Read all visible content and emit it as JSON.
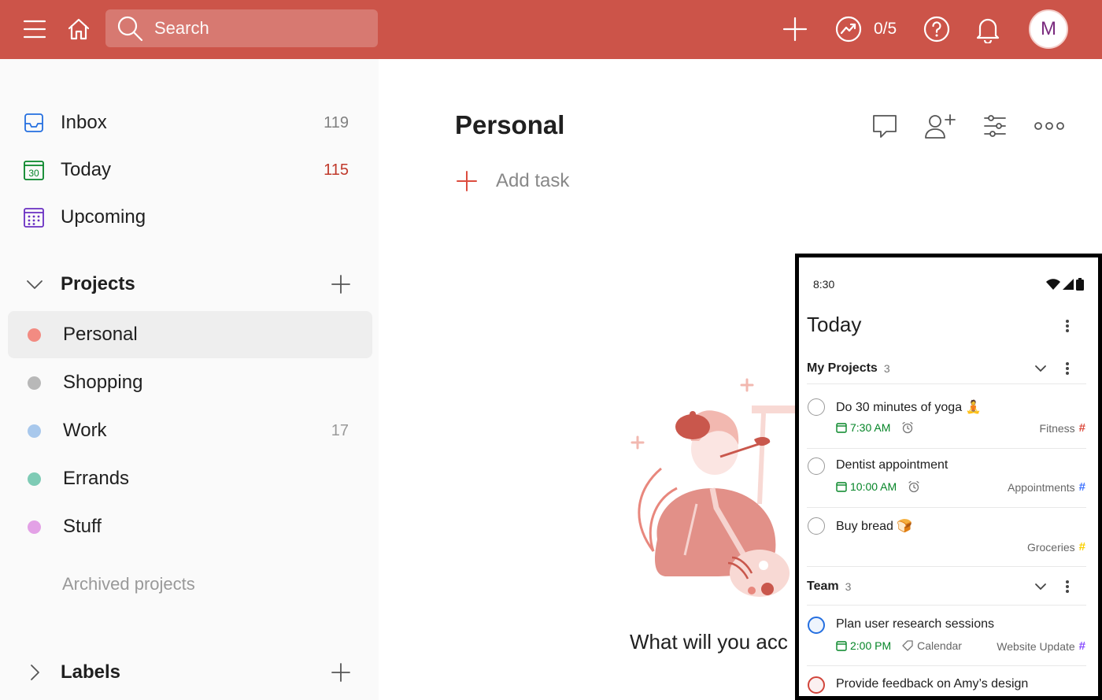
{
  "topbar": {
    "search_placeholder": "Search",
    "karma": "0/5",
    "avatar_initial": "M",
    "colors": {
      "bar": "#cc5449"
    }
  },
  "sidebar": {
    "nav": [
      {
        "label": "Inbox",
        "count": "119",
        "icon": "inbox-icon"
      },
      {
        "label": "Today",
        "count": "115",
        "icon": "calendar-today-icon",
        "day": "30"
      },
      {
        "label": "Upcoming",
        "count": "",
        "icon": "calendar-grid-icon"
      }
    ],
    "projects_title": "Projects",
    "projects": [
      {
        "label": "Personal",
        "count": "",
        "color": "#f28b82"
      },
      {
        "label": "Shopping",
        "count": "",
        "color": "#b8b8b8"
      },
      {
        "label": "Work",
        "count": "17",
        "color": "#a8c8ec"
      },
      {
        "label": "Errands",
        "count": "",
        "color": "#7ecbb5"
      },
      {
        "label": "Stuff",
        "count": "",
        "color": "#e3a1e6"
      }
    ],
    "archived_label": "Archived projects",
    "labels_title": "Labels"
  },
  "main": {
    "title": "Personal",
    "add_task": "Add task",
    "empty_text": "What will you acc"
  },
  "phone": {
    "time": "8:30",
    "title": "Today",
    "sections": [
      {
        "title": "My Projects",
        "count": "3",
        "tasks": [
          {
            "title": "Do 30 minutes of yoga 🧘",
            "time": "7:30 AM",
            "project": "Fitness",
            "hash_color": "#db4c3f"
          },
          {
            "title": "Dentist appointment",
            "time": "10:00 AM",
            "project": "Appointments",
            "hash_color": "#4073ff"
          },
          {
            "title": "Buy bread 🍞",
            "time": "",
            "project": "Groceries",
            "hash_color": "#fad000"
          }
        ]
      },
      {
        "title": "Team",
        "count": "3",
        "tasks": [
          {
            "title": "Plan user research sessions",
            "time": "2:00 PM",
            "label": "Calendar",
            "project": "Website Update",
            "hash_color": "#884dff"
          },
          {
            "title": "Provide feedback on Amy’s design",
            "time": "",
            "project": "",
            "hash_color": ""
          }
        ]
      }
    ]
  }
}
